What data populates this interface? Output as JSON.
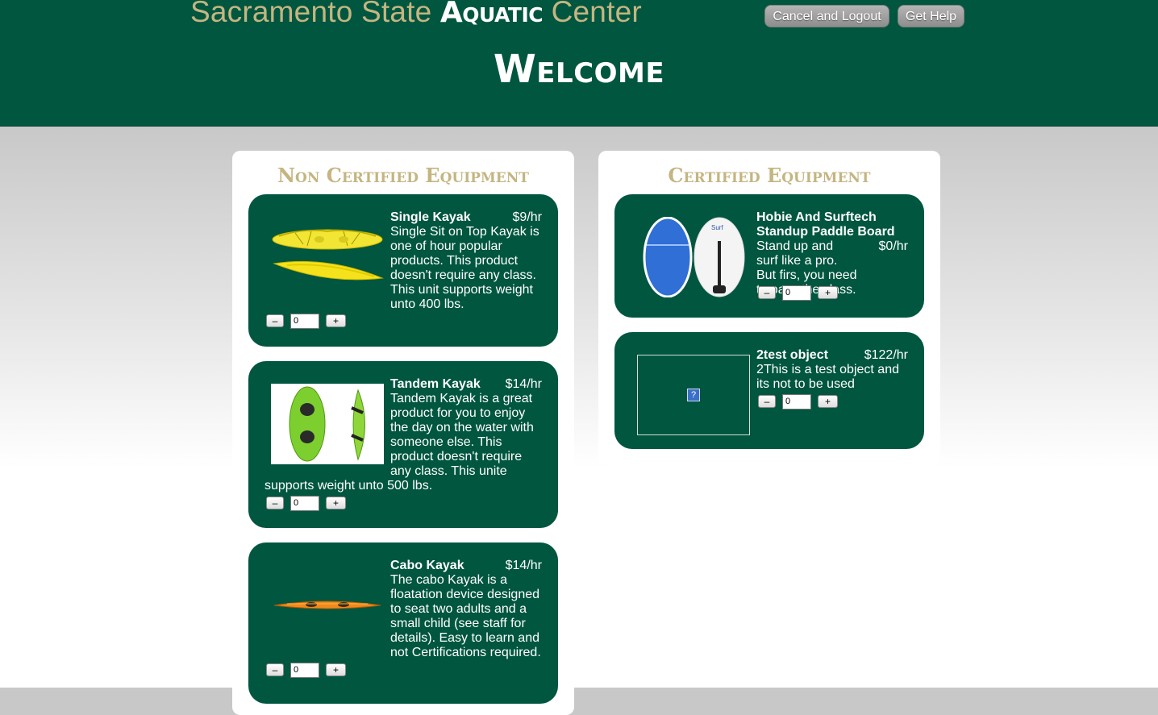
{
  "header": {
    "title_part1": "Sacramento State",
    "title_part2": "Aquatic",
    "title_part3": "Center",
    "cancel_logout_label": "Cancel and Logout",
    "get_help_label": "Get Help",
    "welcome": "Welcome"
  },
  "colors": {
    "brand_green": "#00563f",
    "gold": "#c4b581"
  },
  "non_certified": {
    "title": "Non Certified Equipment",
    "items": [
      {
        "name": "Single Kayak",
        "price": "$9/hr",
        "description": "Single Sit on Top Kayak is one of hour popular products. This product doesn't require any class. This unit supports weight unto 400 lbs.",
        "quantity": "0",
        "image": "yellow-single-kayak"
      },
      {
        "name": "Tandem Kayak",
        "price": "$14/hr",
        "description": "Tandem Kayak is a great product for you to enjoy the day on the water with someone else. This product doesn't require any class. This unite",
        "description_tail": "supports weight unto 500 lbs.",
        "quantity": "0",
        "image": "green-tandem-kayak"
      },
      {
        "name": "Cabo Kayak",
        "price": "$14/hr",
        "description": "The cabo Kayak is a floatation device designed to seat two adults and a small child (see staff for details). Easy to learn and not Certifications required.",
        "quantity": "0",
        "image": "orange-cabo-kayak"
      }
    ]
  },
  "certified": {
    "title": "Certified Equipment",
    "items": [
      {
        "name": "Hobie And Surftech Standup Paddle Board",
        "price": "$0/hr",
        "description": "Stand up and surf like a pro. But firs, you need to pass the class.",
        "quantity": "0",
        "image": "paddle-boards"
      },
      {
        "name": "2test object",
        "price": "$122/hr",
        "description": "2This is a test object and its not to be used",
        "quantity": "0",
        "image": "missing-image"
      }
    ]
  },
  "quantity_controls": {
    "minus": "–",
    "plus": "+"
  }
}
